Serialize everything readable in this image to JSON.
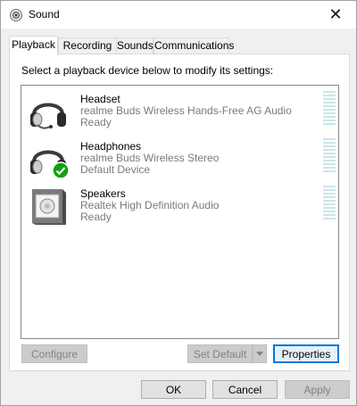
{
  "window": {
    "title": "Sound",
    "close_glyph": "✕"
  },
  "tabs": [
    {
      "label": "Playback",
      "active": true
    },
    {
      "label": "Recording",
      "active": false
    },
    {
      "label": "Sounds",
      "active": false
    },
    {
      "label": "Communications",
      "active": false
    }
  ],
  "instruction": "Select a playback device below to modify its settings:",
  "devices": [
    {
      "name": "Headset",
      "description": "realme Buds Wireless Hands-Free AG Audio",
      "status": "Ready",
      "icon": "headset-icon",
      "default": false,
      "level": 0
    },
    {
      "name": "Headphones",
      "description": "realme Buds Wireless Stereo",
      "status": "Default Device",
      "icon": "headphones-icon",
      "default": true,
      "level": 0
    },
    {
      "name": "Speakers",
      "description": "Realtek High Definition Audio",
      "status": "Ready",
      "icon": "speaker-icon",
      "default": false,
      "level": 0
    }
  ],
  "panel_buttons": {
    "configure": "Configure",
    "set_default": "Set Default",
    "properties": "Properties"
  },
  "dialog_buttons": {
    "ok": "OK",
    "cancel": "Cancel",
    "apply": "Apply"
  },
  "colors": {
    "accent": "#0078d7",
    "check_green": "#13a10e",
    "meter": "#c9e6e9"
  }
}
